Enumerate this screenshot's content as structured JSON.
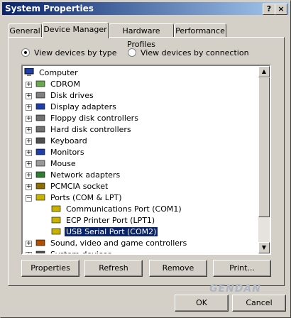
{
  "window": {
    "title": "System Properties",
    "help_btn": "?",
    "close_btn": "×"
  },
  "tabs": [
    {
      "label": "General"
    },
    {
      "label": "Device Manager"
    },
    {
      "label": "Hardware Profiles"
    },
    {
      "label": "Performance"
    }
  ],
  "view": {
    "by_type": "View devices by type",
    "by_connection": "View devices by connection",
    "selected": "by_type"
  },
  "tree": {
    "root": "Computer",
    "items": [
      {
        "label": "CDROM",
        "icon": "cdrom-icon"
      },
      {
        "label": "Disk drives",
        "icon": "disk-drive-icon"
      },
      {
        "label": "Display adapters",
        "icon": "display-adapter-icon"
      },
      {
        "label": "Floppy disk controllers",
        "icon": "floppy-controller-icon"
      },
      {
        "label": "Hard disk controllers",
        "icon": "hard-disk-controller-icon"
      },
      {
        "label": "Keyboard",
        "icon": "keyboard-icon"
      },
      {
        "label": "Monitors",
        "icon": "monitor-icon"
      },
      {
        "label": "Mouse",
        "icon": "mouse-icon"
      },
      {
        "label": "Network adapters",
        "icon": "network-adapter-icon"
      },
      {
        "label": "PCMCIA socket",
        "icon": "pcmcia-icon"
      },
      {
        "label": "Ports (COM & LPT)",
        "icon": "port-icon",
        "expanded": true
      },
      {
        "label": "Communications Port (COM1)",
        "icon": "port-icon",
        "child": true
      },
      {
        "label": "ECP Printer Port (LPT1)",
        "icon": "port-icon",
        "child": true
      },
      {
        "label": "USB Serial Port (COM2)",
        "icon": "port-icon",
        "child": true,
        "selected": true
      },
      {
        "label": "Sound, video and game controllers",
        "icon": "sound-icon"
      },
      {
        "label": "System devices",
        "icon": "system-device-icon"
      }
    ]
  },
  "buttons": {
    "properties": "Properties",
    "refresh": "Refresh",
    "remove": "Remove",
    "print": "Print...",
    "ok": "OK",
    "cancel": "Cancel"
  },
  "watermark": "GENDAN"
}
